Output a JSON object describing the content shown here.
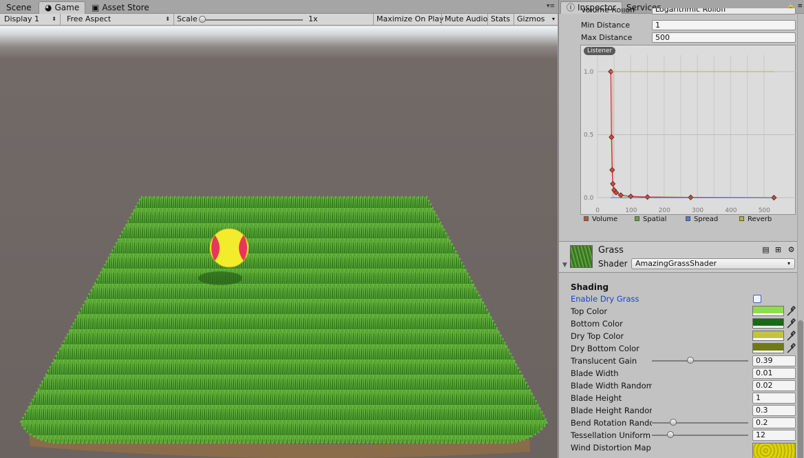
{
  "game_tabs": {
    "scene": "Scene",
    "game": "Game",
    "asset_store": "Asset Store"
  },
  "toolbar": {
    "display": "Display 1",
    "aspect": "Free Aspect",
    "scale_label": "Scale",
    "scale_value": "1x",
    "maximize": "Maximize On Play",
    "mute": "Mute Audio",
    "stats": "Stats",
    "gizmos": "Gizmos"
  },
  "inspector_tabs": {
    "inspector": "Inspector",
    "services": "Services"
  },
  "audio": {
    "rolloff_label": "Volume Rolloff",
    "rolloff_value": "Logarithmic Rolloff",
    "min_label": "Min Distance",
    "min_value": "1",
    "max_label": "Max Distance",
    "max_value": "500",
    "listener_badge": "Listener"
  },
  "chart_data": {
    "type": "line",
    "title": "",
    "xlim": [
      0,
      550
    ],
    "ylim": [
      0,
      1.0
    ],
    "x_ticks": [
      "0",
      "100",
      "200",
      "300",
      "400",
      "500"
    ],
    "y_ticks": [
      "0.0",
      "0.5",
      "1.0"
    ],
    "series": [
      {
        "name": "Volume",
        "color": "#c0392b",
        "x": [
          40,
          42,
          44,
          46,
          50,
          56,
          70,
          100,
          150,
          280,
          530
        ],
        "y": [
          1.0,
          0.48,
          0.22,
          0.11,
          0.06,
          0.04,
          0.02,
          0.01,
          0.005,
          0.002,
          0.0
        ]
      },
      {
        "name": "Spatial",
        "color": "#5cab3e",
        "x": [
          40,
          530
        ],
        "y": [
          1.0,
          1.0
        ]
      },
      {
        "name": "Spread",
        "color": "#3f6bd6",
        "x": [
          40,
          530
        ],
        "y": [
          0.0,
          0.0
        ]
      },
      {
        "name": "Reverb",
        "color": "#b8b23b",
        "x": [
          40,
          530
        ],
        "y": [
          1.0,
          1.0
        ]
      }
    ],
    "legend": [
      "Volume",
      "Spatial",
      "Spread",
      "Reverb"
    ],
    "legend_colors": [
      "#d24a3a",
      "#5cab3e",
      "#4b7be0",
      "#b8b23b"
    ]
  },
  "material": {
    "name": "Grass",
    "shader_label": "Shader",
    "shader_value": "AmazingGrassShader"
  },
  "shading": {
    "title": "Shading",
    "enable_dry": "Enable Dry Grass",
    "top_color": "Top Color",
    "top_color_hex": "#8fdc4e",
    "bottom_color": "Bottom Color",
    "bottom_color_hex": "#176b14",
    "dry_top_color": "Dry Top Color",
    "dry_top_color_hex": "#c2c440",
    "dry_bottom_color": "Dry Bottom Color",
    "dry_bottom_color_hex": "#6f7a15",
    "translucent_gain": "Translucent Gain",
    "translucent_gain_value": "0.39",
    "blade_width": "Blade Width",
    "blade_width_value": "0.01",
    "blade_width_random": "Blade Width Random",
    "blade_width_random_value": "0.02",
    "blade_height": "Blade Height",
    "blade_height_value": "1",
    "blade_height_random": "Blade Height Random",
    "blade_height_random_value": "0.3",
    "bend_rotation": "Bend Rotation Random",
    "bend_rotation_value": "0.2",
    "tessellation": "Tessellation Uniform",
    "tessellation_value": "12",
    "wind_map": "Wind Distortion Map"
  }
}
